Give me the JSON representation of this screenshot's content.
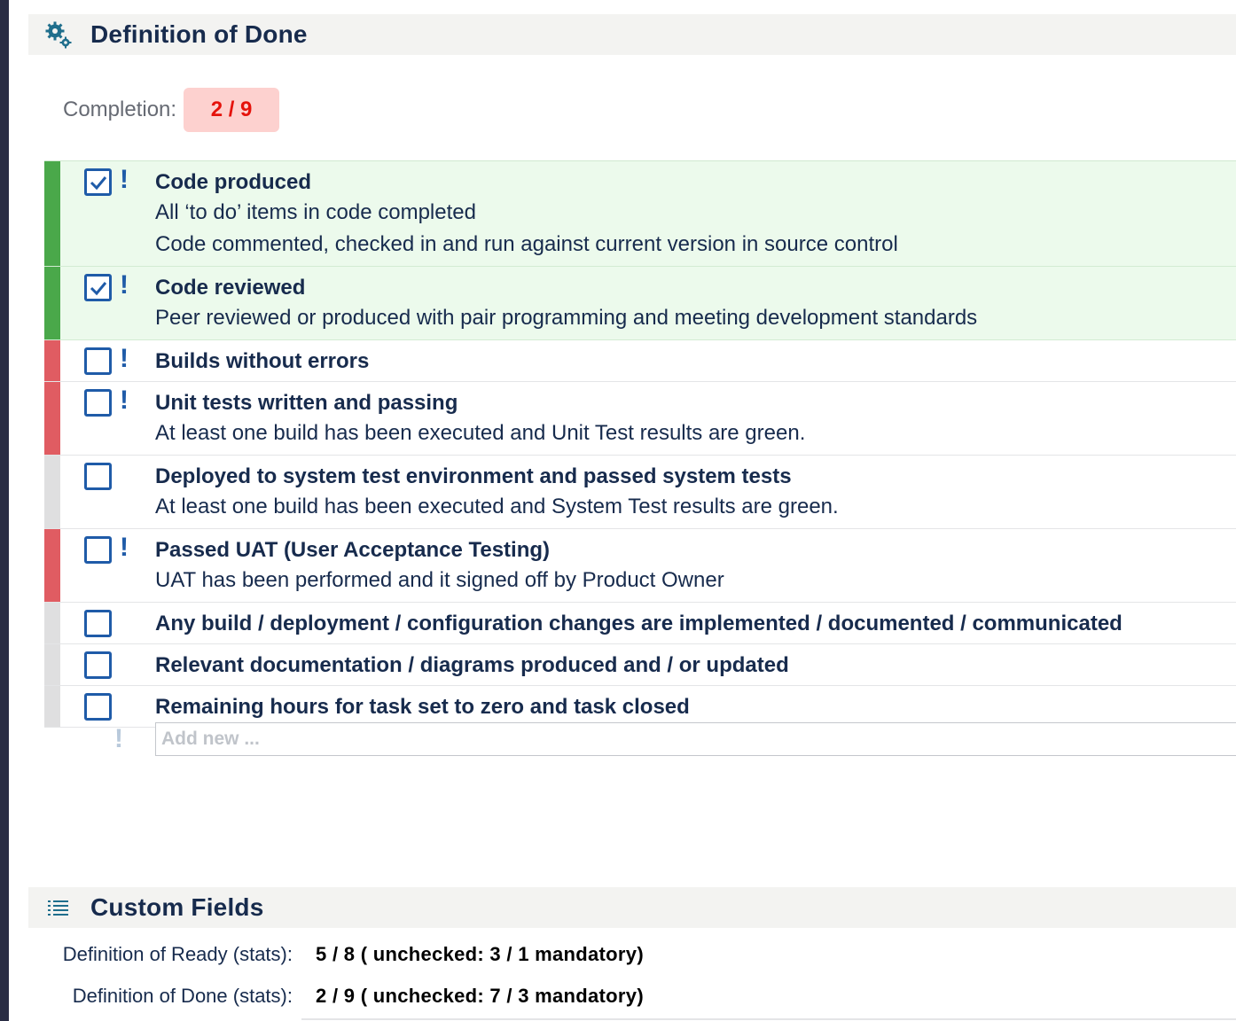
{
  "dod": {
    "title": "Definition of Done",
    "completion_label": "Completion:",
    "completion_value": "2 / 9",
    "items": [
      {
        "title": "Code produced",
        "desc": [
          "All ‘to do’ items in code completed",
          "Code commented, checked in and run against current version in source control"
        ],
        "checked": true,
        "mandatory": true
      },
      {
        "title": "Code reviewed",
        "desc": [
          "Peer reviewed or produced with pair programming and meeting development standards"
        ],
        "checked": true,
        "mandatory": true
      },
      {
        "title": "Builds without errors",
        "desc": [],
        "checked": false,
        "mandatory": true
      },
      {
        "title": "Unit tests written and passing",
        "desc": [
          "At least one build has been executed and Unit Test results are green."
        ],
        "checked": false,
        "mandatory": true
      },
      {
        "title": "Deployed to system test environment and passed system tests",
        "desc": [
          "At least one build has been executed and System Test results are green."
        ],
        "checked": false,
        "mandatory": false
      },
      {
        "title": "Passed UAT (User Acceptance Testing)",
        "desc": [
          "UAT has been performed and it signed off by Product Owner"
        ],
        "checked": false,
        "mandatory": true
      },
      {
        "title": "Any build / deployment / configuration changes are implemented / documented / communicated",
        "desc": [],
        "checked": false,
        "mandatory": false
      },
      {
        "title": "Relevant documentation / diagrams produced and / or updated",
        "desc": [],
        "checked": false,
        "mandatory": false
      },
      {
        "title": "Remaining hours for task set to zero and task closed",
        "desc": [],
        "checked": false,
        "mandatory": false
      }
    ],
    "add_new_placeholder": "Add new ..."
  },
  "custom_fields": {
    "title": "Custom Fields",
    "rows": [
      {
        "label": "Definition of Ready (stats):",
        "value": "5 / 8 ( unchecked: 3 / 1 mandatory)"
      },
      {
        "label": "Definition of Done (stats):",
        "value": "2 / 9 ( unchecked: 7 / 3 mandatory)"
      }
    ]
  },
  "colors": {
    "checked_green": "#4aa84a",
    "mandatory_red": "#e05c62",
    "optional_grey": "#dfdfe0",
    "accent_blue": "#1f5ba8",
    "badge_bg": "#fdd1cf",
    "badge_text": "#e5120b"
  },
  "icons": {
    "dod_header": "gears-icon",
    "cf_header": "list-icon",
    "checkbox_checked": "checkmark-icon",
    "mandatory": "exclamation-icon"
  }
}
